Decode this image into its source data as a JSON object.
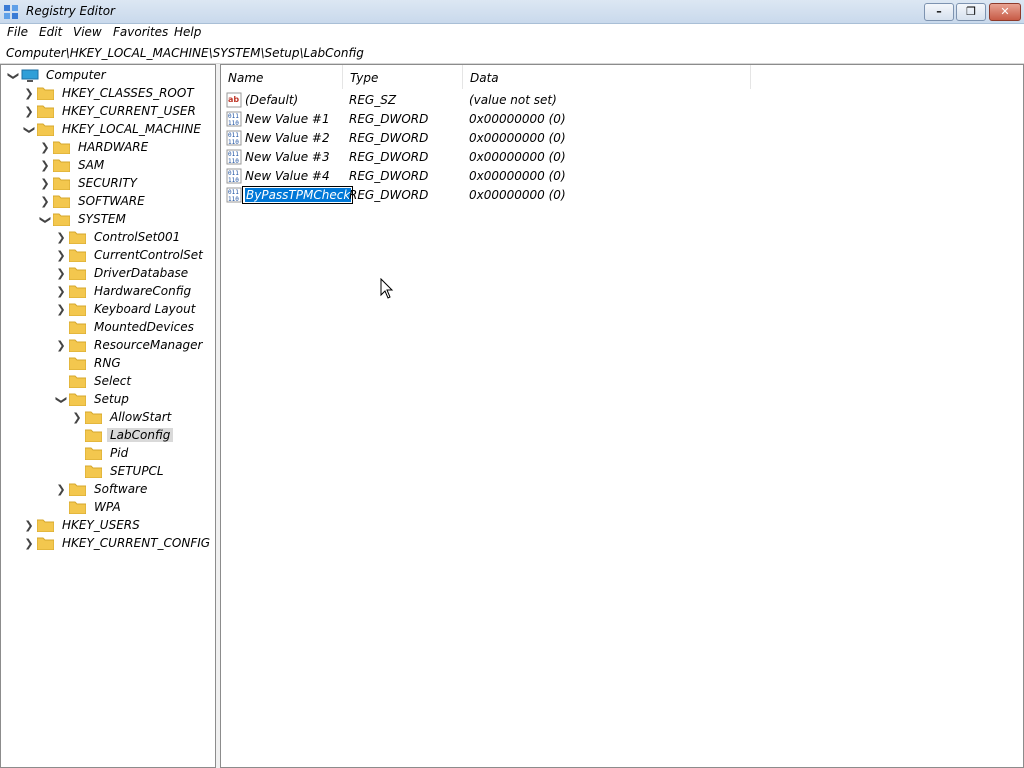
{
  "window": {
    "title": "Registry Editor",
    "minimize_glyph": "–",
    "maximize_glyph": "❐",
    "close_glyph": "✕"
  },
  "menu": [
    "File",
    "Edit",
    "View",
    "Favorites",
    "Help"
  ],
  "address": "Computer\\HKEY_LOCAL_MACHINE\\SYSTEM\\Setup\\LabConfig",
  "tree": {
    "root": "Computer",
    "hkcr": "HKEY_CLASSES_ROOT",
    "hkcu": "HKEY_CURRENT_USER",
    "hklm": "HKEY_LOCAL_MACHINE",
    "hardware": "HARDWARE",
    "sam": "SAM",
    "security": "SECURITY",
    "software": "SOFTWARE",
    "system": "SYSTEM",
    "controlset001": "ControlSet001",
    "currentcontrolset": "CurrentControlSet",
    "driverdatabase": "DriverDatabase",
    "hardwareconfig": "HardwareConfig",
    "keyboardlayout": "Keyboard Layout",
    "mounteddevices": "MountedDevices",
    "resourcemanager": "ResourceManager",
    "rng": "RNG",
    "select": "Select",
    "setup": "Setup",
    "allowstart": "AllowStart",
    "labconfig": "LabConfig",
    "pid": "Pid",
    "setupcpl": "SETUPCL",
    "software2": "Software",
    "wpa": "WPA",
    "hku": "HKEY_USERS",
    "hkcc": "HKEY_CURRENT_CONFIG"
  },
  "columns": {
    "name": "Name",
    "type": "Type",
    "data": "Data"
  },
  "values": [
    {
      "name": "(Default)",
      "type": "REG_SZ",
      "data": "(value not set)",
      "icon": "string-value-icon"
    },
    {
      "name": "New Value #1",
      "type": "REG_DWORD",
      "data": "0x00000000 (0)",
      "icon": "dword-value-icon"
    },
    {
      "name": "New Value #2",
      "type": "REG_DWORD",
      "data": "0x00000000 (0)",
      "icon": "dword-value-icon"
    },
    {
      "name": "New Value #3",
      "type": "REG_DWORD",
      "data": "0x00000000 (0)",
      "icon": "dword-value-icon"
    },
    {
      "name": "New Value #4",
      "type": "REG_DWORD",
      "data": "0x00000000 (0)",
      "icon": "dword-value-icon"
    },
    {
      "name": "ByPassTPMCheck",
      "type": "REG_DWORD",
      "data": "0x00000000 (0)",
      "icon": "dword-value-icon"
    }
  ],
  "colors": {
    "selection": "#0078d7",
    "folder": "#f3c74e",
    "tree_selected": "#d9d9d9"
  }
}
